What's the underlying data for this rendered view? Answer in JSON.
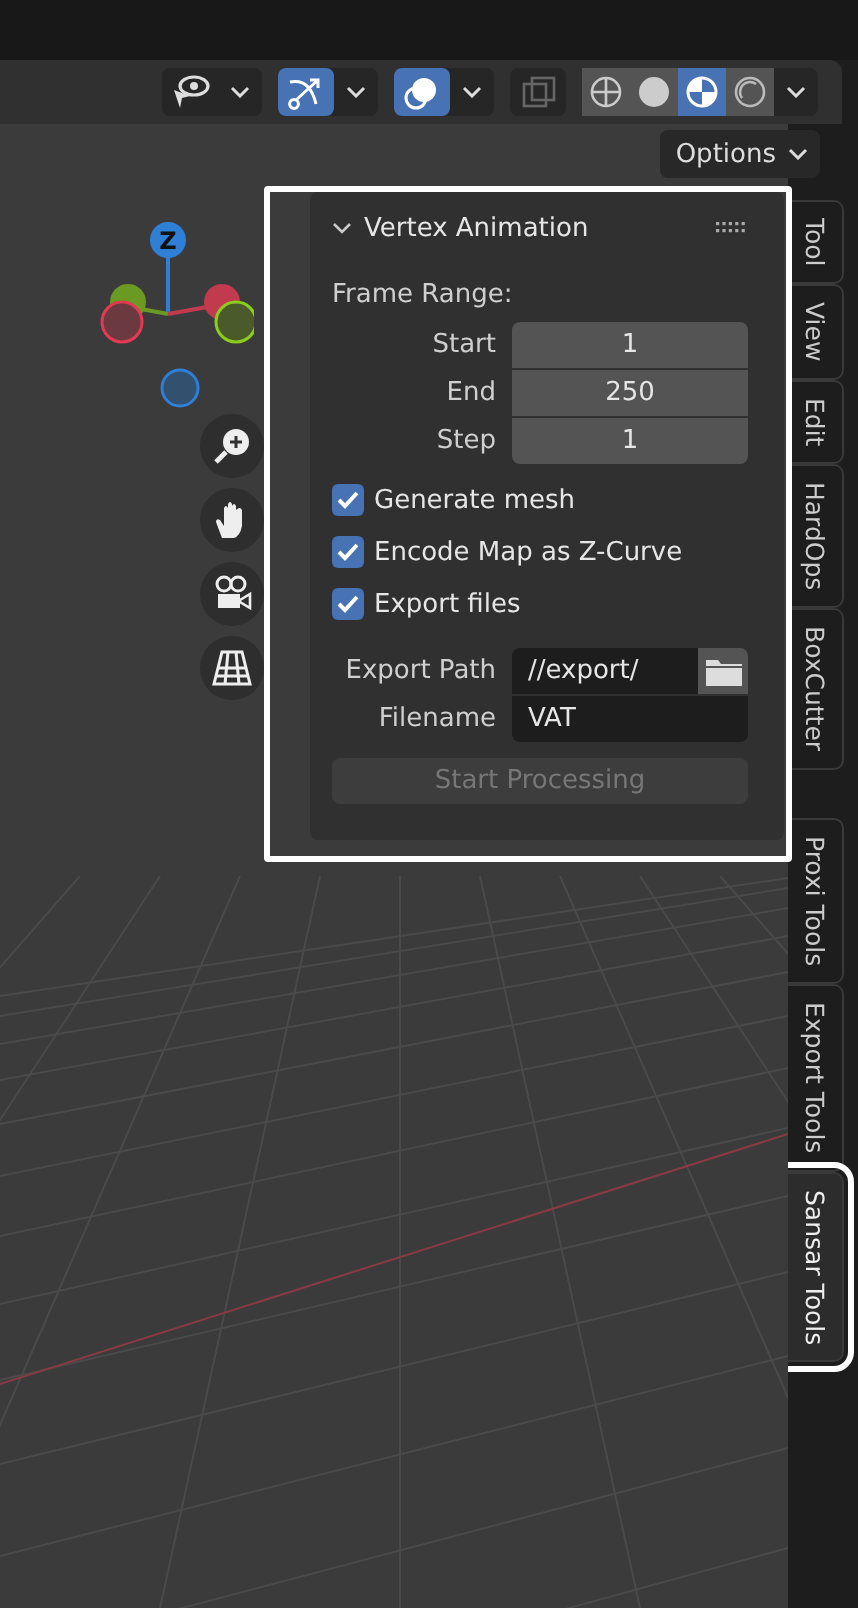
{
  "header": {
    "tools": [
      {
        "kind": "visibility",
        "active": false
      },
      {
        "kind": "gizmo",
        "active": true
      },
      {
        "kind": "overlay",
        "active": true
      },
      {
        "kind": "xray",
        "active": false
      }
    ],
    "shading": [
      {
        "kind": "wireframe",
        "selected": false
      },
      {
        "kind": "solid",
        "selected": false
      },
      {
        "kind": "material",
        "selected": true
      },
      {
        "kind": "rendered",
        "selected": false
      }
    ]
  },
  "options_button": {
    "label": "Options"
  },
  "gizmo": {
    "axes": [
      {
        "label": "Z"
      }
    ]
  },
  "panel": {
    "title": "Vertex Animation",
    "expanded": true,
    "frame_range": {
      "label": "Frame Range:",
      "fields": [
        {
          "label": "Start",
          "value": "1"
        },
        {
          "label": "End",
          "value": "250"
        },
        {
          "label": "Step",
          "value": "1"
        }
      ]
    },
    "checkboxes": [
      {
        "label": "Generate mesh",
        "checked": true
      },
      {
        "label": "Encode Map as Z-Curve",
        "checked": true
      },
      {
        "label": "Export files",
        "checked": true
      }
    ],
    "export_path": {
      "label": "Export Path",
      "value": "//export/"
    },
    "filename": {
      "label": "Filename",
      "value": "VAT"
    },
    "start_button": {
      "label": "Start Processing",
      "disabled": true
    }
  },
  "tabs": [
    {
      "label": "Tool",
      "selected": false
    },
    {
      "label": "View",
      "selected": false
    },
    {
      "label": "Edit",
      "selected": false
    },
    {
      "label": "HardOps",
      "selected": false
    },
    {
      "label": "BoxCutter",
      "selected": false
    },
    {
      "label": "Proxi Tools",
      "selected": false
    },
    {
      "label": "Export Tools",
      "selected": false
    },
    {
      "label": "Sansar Tools",
      "selected": true
    }
  ]
}
